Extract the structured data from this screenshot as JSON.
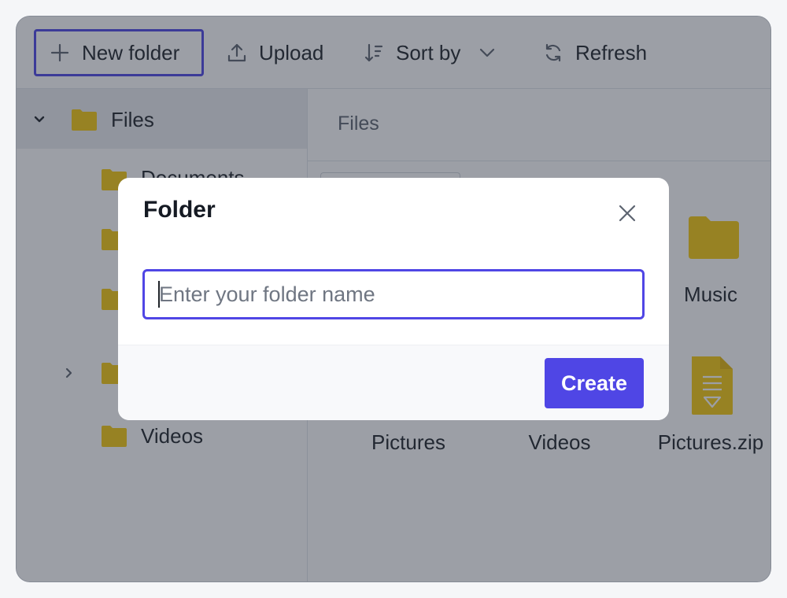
{
  "toolbar": {
    "new_folder_label": "New folder",
    "upload_label": "Upload",
    "sort_label": "Sort by",
    "refresh_label": "Refresh"
  },
  "sidebar": {
    "root_label": "Files",
    "items": [
      {
        "label": "Documents"
      },
      {
        "label": ""
      },
      {
        "label": ""
      },
      {
        "label": ""
      },
      {
        "label": "Videos"
      }
    ]
  },
  "main": {
    "breadcrumb": "Files",
    "items": [
      {
        "label": "Music",
        "type": "folder"
      },
      {
        "label": "Pictures",
        "type": "folder"
      },
      {
        "label": "Videos",
        "type": "folder"
      },
      {
        "label": "Pictures.zip",
        "type": "zip"
      }
    ]
  },
  "dialog": {
    "title": "Folder",
    "input_value": "",
    "input_placeholder": "Enter your folder name",
    "create_label": "Create"
  },
  "colors": {
    "accent": "#4f46e5",
    "folder": "#f6c90e",
    "overlay": "rgba(40,45,60,0.46)"
  }
}
